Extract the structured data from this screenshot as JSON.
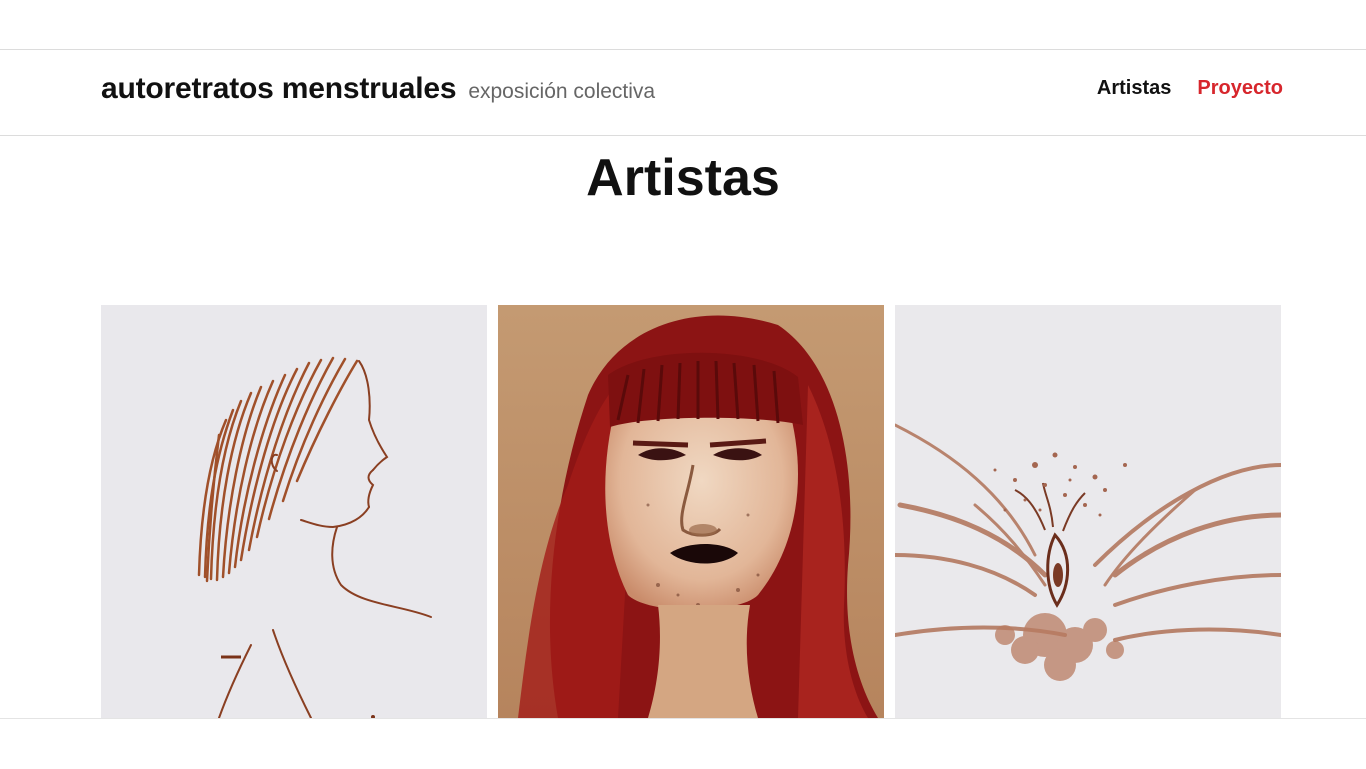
{
  "site": {
    "title": "autoretratos menstruales",
    "subtitle": "exposición colectiva"
  },
  "nav": {
    "items": [
      {
        "label": "Artistas"
      },
      {
        "label": "Proyecto"
      }
    ]
  },
  "main": {
    "heading": "Artistas"
  },
  "gallery": {
    "artworks": [
      {
        "icon": "profile-line-drawing"
      },
      {
        "icon": "red-haired-portrait"
      },
      {
        "icon": "abstract-floral"
      }
    ]
  },
  "colors": {
    "accent": "#d7262c",
    "text": "#111111",
    "muted": "#666666"
  }
}
